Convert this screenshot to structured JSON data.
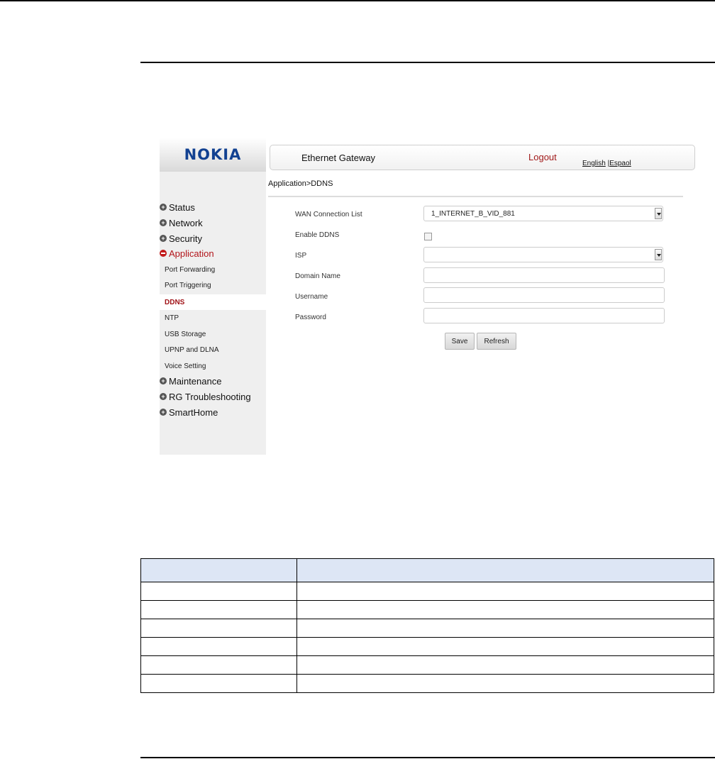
{
  "app": {
    "logo": "NOKIA",
    "header_title": "Ethernet Gateway",
    "logout_label": "Logout",
    "lang_english": "English",
    "lang_separator": " |",
    "lang_spanish": "Espaol",
    "breadcrumb": "Application>DDNS"
  },
  "sidebar": {
    "top_items": [
      {
        "label": "Status"
      },
      {
        "label": "Network"
      },
      {
        "label": "Security"
      },
      {
        "label": "Application"
      }
    ],
    "sub_items": [
      {
        "label": "Port Forwarding"
      },
      {
        "label": "Port Triggering"
      },
      {
        "label": "DDNS"
      },
      {
        "label": "NTP"
      },
      {
        "label": "USB Storage"
      },
      {
        "label": "UPNP and DLNA"
      },
      {
        "label": "Voice Setting"
      }
    ],
    "bottom_items": [
      {
        "label": "Maintenance"
      },
      {
        "label": "RG Troubleshooting"
      },
      {
        "label": "SmartHome"
      }
    ],
    "active_color": "#b2141a"
  },
  "form": {
    "wan_label": "WAN Connection List",
    "wan_value": "1_INTERNET_B_VID_881",
    "enable_label": "Enable DDNS",
    "isp_label": "ISP",
    "isp_value": "",
    "domain_label": "Domain Name",
    "domain_value": "",
    "username_label": "Username",
    "username_value": "",
    "password_label": "Password",
    "password_value": "",
    "save_label": "Save",
    "refresh_label": "Refresh"
  },
  "table": {
    "rows": 6
  }
}
